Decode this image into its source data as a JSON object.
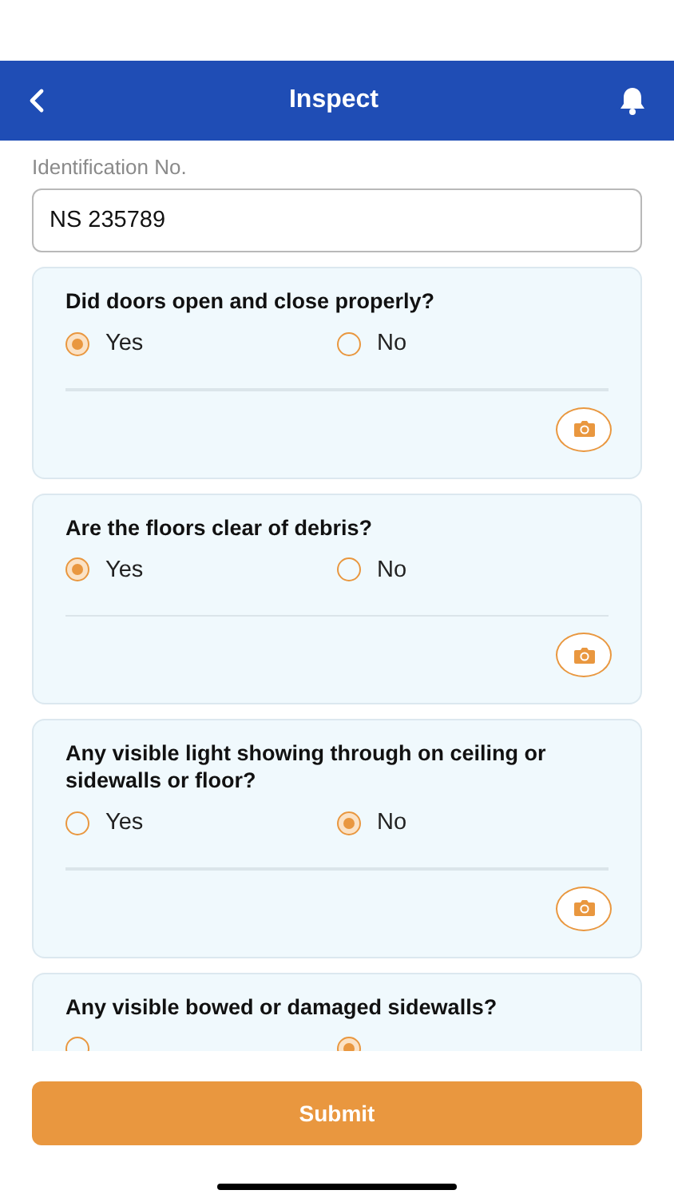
{
  "header": {
    "title": "Inspect"
  },
  "identification": {
    "label": "Identification No.",
    "value": "NS 235789"
  },
  "questions": [
    {
      "question": "Did doors open and close properly?",
      "options": [
        {
          "label": "Yes",
          "selected": true
        },
        {
          "label": "No",
          "selected": false
        }
      ]
    },
    {
      "question": "Are the floors clear of debris?",
      "options": [
        {
          "label": "Yes",
          "selected": true
        },
        {
          "label": "No",
          "selected": false
        }
      ]
    },
    {
      "question": "Any visible light showing through on ceiling or sidewalls or floor?",
      "options": [
        {
          "label": "Yes",
          "selected": false
        },
        {
          "label": "No",
          "selected": true
        }
      ]
    },
    {
      "question": "Any visible bowed or damaged sidewalls?",
      "options": [
        {
          "selected": false
        },
        {
          "selected": true
        }
      ]
    }
  ],
  "submit": "Submit"
}
